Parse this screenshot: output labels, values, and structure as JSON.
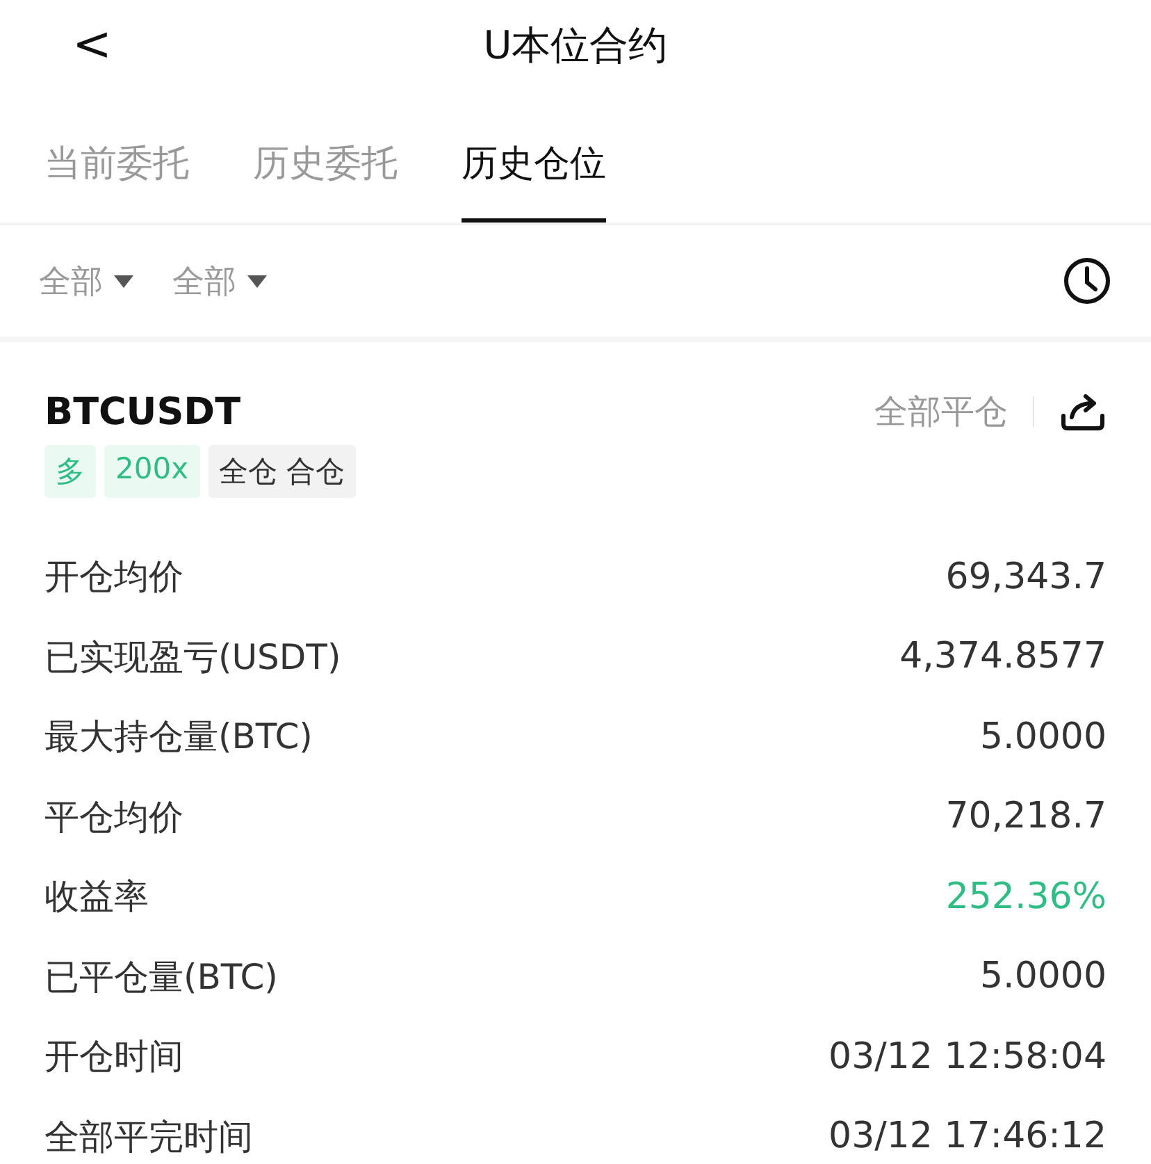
{
  "header": {
    "back": "<",
    "title": "U本位合约"
  },
  "tabs": [
    {
      "label": "当前委托",
      "selected": false
    },
    {
      "label": "历史委托",
      "selected": false
    },
    {
      "label": "历史仓位",
      "selected": true
    }
  ],
  "filters": [
    {
      "label": "全部"
    },
    {
      "label": "全部"
    }
  ],
  "position": {
    "symbol": "BTCUSDT",
    "close_all": "全部平仓",
    "tags": [
      {
        "label": "多",
        "kind": "green"
      },
      {
        "label": "200x",
        "kind": "green"
      },
      {
        "label": "全仓 合仓",
        "kind": "gray"
      }
    ],
    "rows": [
      {
        "label": "开仓均价",
        "value": "69,343.7",
        "positive": false
      },
      {
        "label": "已实现盈亏(USDT)",
        "value": "4,374.8577",
        "positive": false
      },
      {
        "label": "最大持仓量(BTC)",
        "value": "5.0000",
        "positive": false
      },
      {
        "label": "平仓均价",
        "value": "70,218.7",
        "positive": false
      },
      {
        "label": "收益率",
        "value": "252.36%",
        "positive": true
      },
      {
        "label": "已平仓量(BTC)",
        "value": "5.0000",
        "positive": false
      },
      {
        "label": "开仓时间",
        "value": "03/12 12:58:04",
        "positive": false
      },
      {
        "label": "全部平完时间",
        "value": "03/12 17:46:12",
        "positive": false
      }
    ]
  }
}
